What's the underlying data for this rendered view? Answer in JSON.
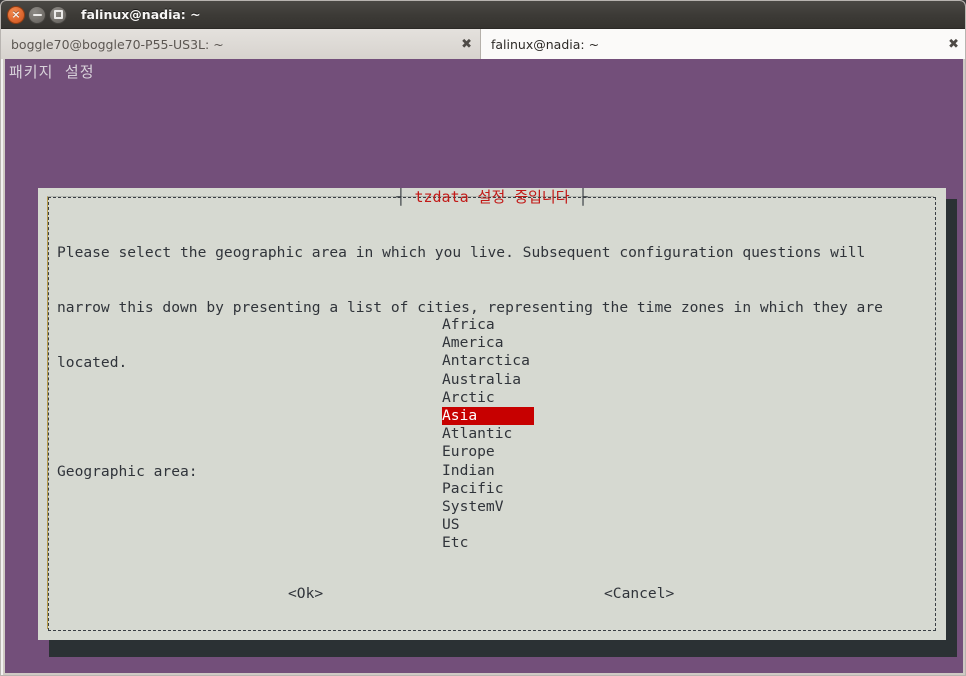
{
  "window": {
    "title": "falinux@nadia: ~",
    "buttons": {
      "close": "×",
      "minimize": "minimize",
      "maximize": "maximize"
    }
  },
  "tabs": [
    {
      "label": "boggle70@boggle70-P55-US3L: ~",
      "close": "✖",
      "active": false
    },
    {
      "label": "falinux@nadia: ~",
      "close": "✖",
      "active": true
    }
  ],
  "terminal": {
    "header": "패키지  설정",
    "background_color": "#734f7a"
  },
  "dialog": {
    "title": "tzdata 설정 중입니다",
    "title_left_bar": "┤ ",
    "title_right_bar": " ├",
    "title_color": "#c21a18",
    "background_color": "#d6d9d1",
    "body_lines": [
      "Please select the geographic area in which you live. Subsequent configuration questions will",
      "narrow this down by presenting a list of cities, representing the time zones in which they are",
      "located."
    ],
    "field_label": "Geographic area:",
    "list": {
      "items": [
        "Africa",
        "America",
        "Antarctica",
        "Australia",
        "Arctic",
        "Asia",
        "Atlantic",
        "Europe",
        "Indian",
        "Pacific",
        "SystemV",
        "US",
        "Etc"
      ],
      "selected_index": 5,
      "selected_value": "Asia",
      "highlight_color": "#c70000",
      "highlight_text_color": "#ffffff"
    },
    "buttons": {
      "ok": "<Ok>",
      "cancel": "<Cancel>"
    }
  }
}
